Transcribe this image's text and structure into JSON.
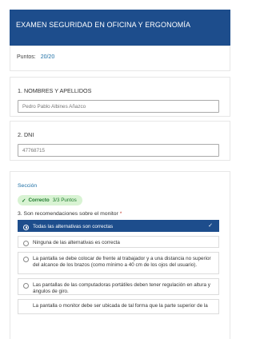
{
  "header": {
    "title": "EXAMEN SEGURIDAD EN OFICINA Y ERGONOMÍA"
  },
  "score": {
    "label": "Puntos:",
    "value": "20/20"
  },
  "q1": {
    "label": "1. NOMBRES Y APELLIDOS",
    "value": "Pedro Pablo Albines Añazco"
  },
  "q2": {
    "label": "2. DNI",
    "value": "47768715"
  },
  "section": {
    "title": "Sección",
    "badge_status": "Correcto",
    "badge_points": "3/3 Puntos",
    "question_label": "3. Son recomendaciones sobre el monitor",
    "required_mark": "*",
    "options": [
      {
        "text": "Todas las alternativas son correctas",
        "selected": true
      },
      {
        "text": "Ninguna de las alternativas es correcta",
        "selected": false
      },
      {
        "text": "La pantalla se debe colocar de frente al trabajador y a una distancia no superior del alcance de los brazos (como mínimo a 40 cm de los ojos del usuario).",
        "selected": false
      },
      {
        "text": "Las pantallas de las computadoras portátiles deben tener regulación en altura y ángulos de giro.",
        "selected": false
      },
      {
        "text": "La pantalla o monitor debe ser ubicada de tal forma que la parte superior de la",
        "selected": false
      }
    ]
  },
  "colors": {
    "header_bg": "#1d4d8c",
    "accent": "#1d6fa5",
    "correct_bg": "#d8f3d3",
    "correct_text": "#1e7a2c"
  }
}
